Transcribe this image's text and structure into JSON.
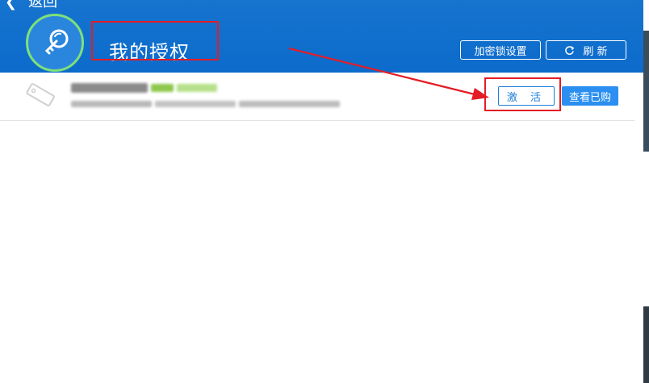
{
  "header": {
    "back_label": "返回",
    "title": "我的授权",
    "lock_settings_label": "加密锁设置",
    "refresh_label": "刷 新"
  },
  "license_row": {
    "activate_label": "激 活",
    "view_purchased_label": "查看已购"
  },
  "icons": [
    "chevron-left-icon",
    "key-icon",
    "refresh-icon",
    "tag-icon",
    "red-arrow-annotation"
  ],
  "colors": {
    "header_blue": "#0c6bcb",
    "accent_green": "#7ee07a",
    "button_blue": "#2a8ff0",
    "annotation_red": "#e41c25"
  }
}
